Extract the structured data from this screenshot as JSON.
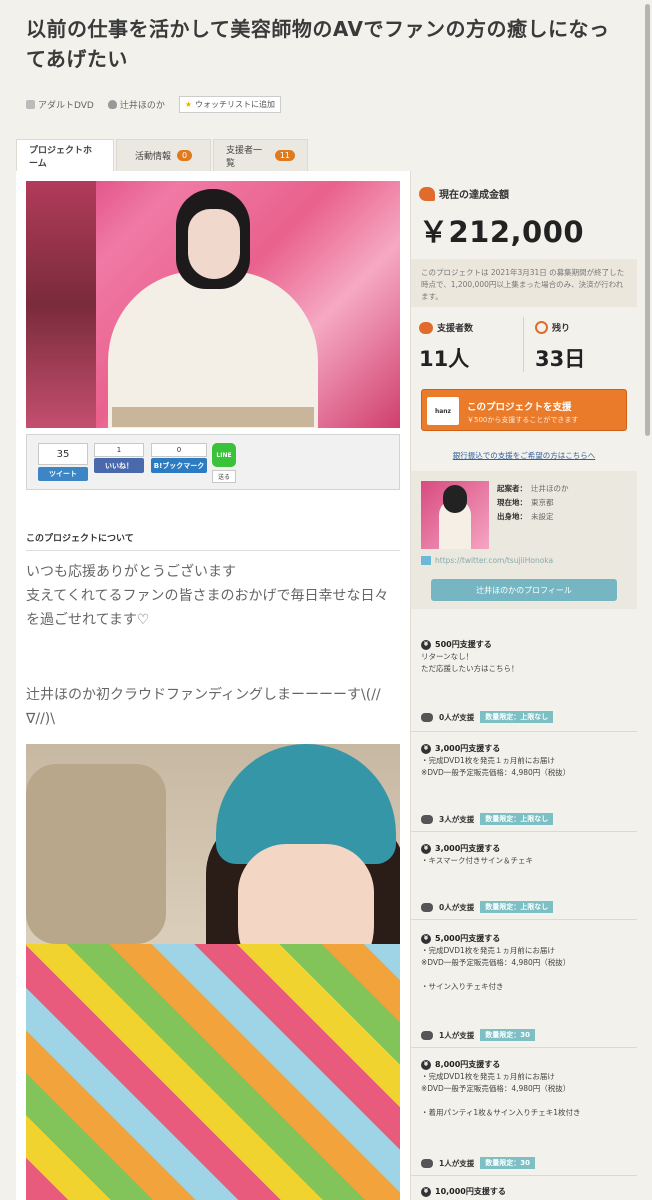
{
  "title": "以前の仕事を活かして美容師物のAVでファンの方の癒しになってあげたい",
  "meta": {
    "category": "アダルトDVD",
    "owner": "辻井ほのか",
    "watchlist": "ウォッチリストに追加"
  },
  "tabs": [
    {
      "label": "プロジェクトホーム"
    },
    {
      "label": "活動情報",
      "badge": "0"
    },
    {
      "label": "支援者一覧",
      "badge": "11"
    }
  ],
  "share": {
    "tweet_count": "35",
    "tweet_label": "ツイート",
    "like_count": "1",
    "like_label": "いいね！",
    "hatena_count": "0",
    "hatena_label": "B!ブックマーク",
    "line_label": "LINE",
    "send_label": "送る"
  },
  "about": {
    "heading": "このプロジェクトについて",
    "para1": "いつも応援ありがとうございます\n支えてくれてるファンの皆さまのおかげで毎日幸せな日々を過ごせれてます♡",
    "para2": "辻井ほのか初クラウドファンディングしまーーーーす\\(//∇//)\\"
  },
  "sidebar": {
    "achieved_label": "現在の達成金額",
    "amount": "￥212,000",
    "note": "このプロジェクトは 2021年3月31日 の募集期間が終了した時点で、1,200,000円以上集まった場合のみ、決済が行われます。",
    "supporters_label": "支援者数",
    "supporters_value": "11人",
    "remaining_label": "残り",
    "remaining_value": "33日",
    "support_button": "このプロジェクトを支援",
    "support_sub": "￥500から支援することができます",
    "support_logo": "hanz",
    "bank_link": "銀行振込での支援をご希望の方はこちらへ",
    "profile": {
      "founder_label": "起案者：",
      "founder": "辻井ほのか",
      "location_label": "現在地：",
      "location": "東京都",
      "origin_label": "出身地：",
      "origin": "未設定",
      "twitter": "https://twitter.com/tsujiiHonoka",
      "profile_button": "辻井ほのかのプロフィール"
    },
    "rewards": [
      {
        "price": "500円支援する",
        "lines": [
          "リターンなし！",
          "ただ応援したい方はこちら！"
        ],
        "count": "0人が支援",
        "limit": "数量限定：上限なし"
      },
      {
        "price": "3,000円支援する",
        "lines": [
          "・完成DVD1枚を発売１ヵ月前にお届け",
          "※DVD一般予定販売価格：4,980円（税抜）"
        ],
        "count": "3人が支援",
        "limit": "数量限定：上限なし"
      },
      {
        "price": "3,000円支援する",
        "lines": [
          "・キスマーク付きサイン＆チェキ"
        ],
        "count": "0人が支援",
        "limit": "数量限定：上限なし"
      },
      {
        "price": "5,000円支援する",
        "lines": [
          "・完成DVD1枚を発売１ヵ月前にお届け",
          "※DVD一般予定販売価格：4,980円（税抜）",
          "",
          "・サイン入りチェキ付き"
        ],
        "count": "1人が支援",
        "limit": "数量限定：30"
      },
      {
        "price": "8,000円支援する",
        "lines": [
          "・完成DVD1枚を発売１ヵ月前にお届け",
          "※DVD一般予定販売価格：4,980円（税抜）",
          "",
          "・着用パンティ1枚＆サイン入りチェキ1枚付き"
        ],
        "count": "1人が支援",
        "limit": "数量限定：30"
      },
      {
        "price": "10,000円支援する",
        "lines": [],
        "count": "",
        "limit": ""
      }
    ]
  }
}
